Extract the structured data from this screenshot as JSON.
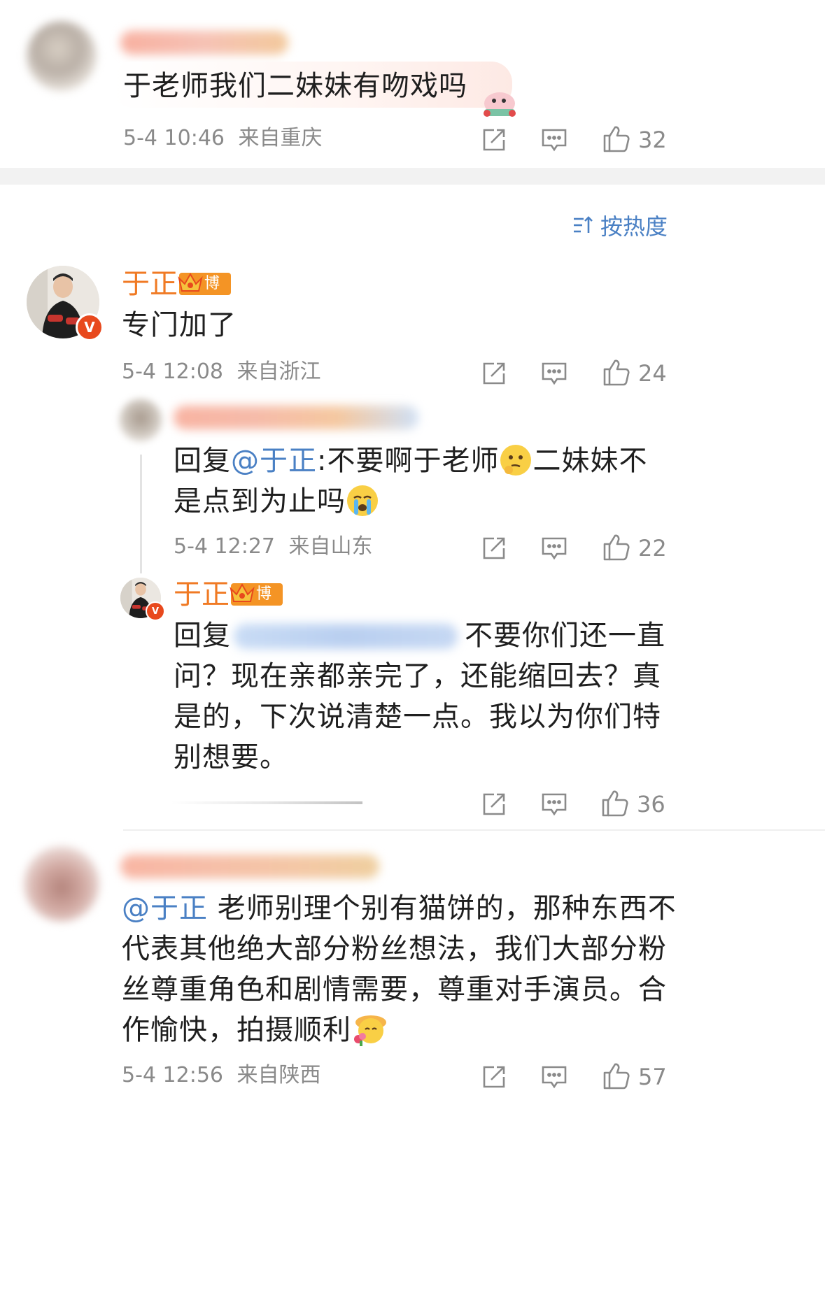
{
  "comments": [
    {
      "text": "于老师我们二妹妹有吻戏吗",
      "time": "5-4 10:46",
      "location": "来自重庆",
      "likes": "32"
    }
  ],
  "sort": {
    "label": "按热度"
  },
  "thread": {
    "author": "于正",
    "badge": "博主",
    "text": "专门加了",
    "time": "5-4 12:08",
    "location": "来自浙江",
    "likes": "24",
    "replies": [
      {
        "prefix": "回复",
        "mention": "@于正",
        "text_line1": ":不要啊于老师",
        "text_line1b": "二妹妹不",
        "text_line2": "是点到为止吗",
        "time": "5-4 12:27",
        "location": "来自山东",
        "likes": "22"
      },
      {
        "author": "于正",
        "badge": "博主",
        "prefix": "回复",
        "text_line1": "不要你们还一直",
        "text_line2": "问？现在亲都亲完了，还能缩回去？真",
        "text_line3": "是的，下次说清楚一点。我以为你们特",
        "text_line4": "别想要。",
        "likes": "36"
      }
    ]
  },
  "last_comment": {
    "mention": "@于正",
    "line1": " 老师别理个别有猫饼的，那种东西不",
    "line2": "代表其他绝大部分粉丝想法，我们大部分粉",
    "line3": "丝尊重角色和剧情需要，尊重对手演员。合",
    "line4": "作愉快，拍摄顺利",
    "time": "5-4 12:56",
    "location": "来自陕西",
    "likes": "57"
  },
  "colors": {
    "name_orange": "#f07a24",
    "mention_blue": "#4a80c4",
    "meta_gray": "#8a8a8a",
    "badge_orange": "#f49425"
  },
  "icons": [
    "share-icon",
    "comment-icon",
    "like-icon",
    "sort-icon",
    "verified-icon",
    "crown-icon"
  ]
}
